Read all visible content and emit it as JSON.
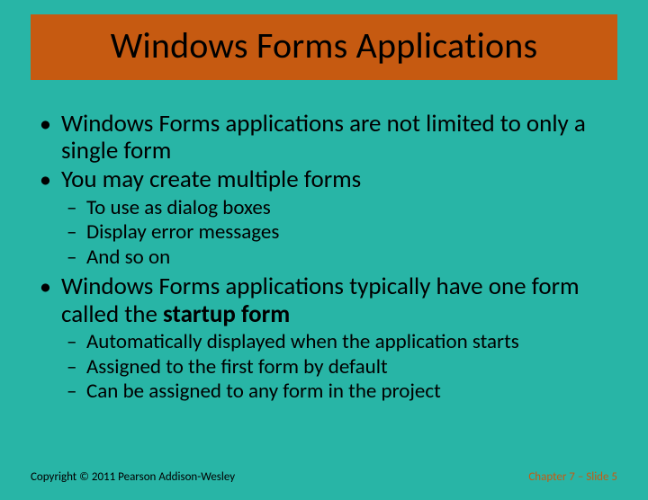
{
  "title": "Windows Forms Applications",
  "bullets": {
    "b1": "Windows Forms applications are not limited to only a single form",
    "b2": "You may create multiple forms",
    "b2_sub": {
      "s1": "To use as dialog boxes",
      "s2": "Display error messages",
      "s3": "And so on"
    },
    "b3_pre": "Windows Forms applications typically have one form called the ",
    "b3_bold": "startup form",
    "b3_sub": {
      "s1": "Automatically displayed when the application starts",
      "s2": "Assigned to the first form by default",
      "s3": "Can be assigned to any form in the project"
    }
  },
  "footer": {
    "copyright": "Copyright © 2011 Pearson Addison-Wesley",
    "location": "Chapter 7 – Slide 5"
  }
}
